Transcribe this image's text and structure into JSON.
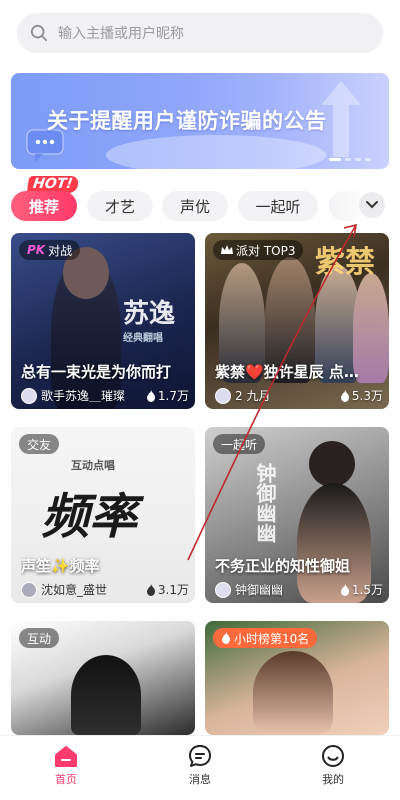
{
  "search": {
    "placeholder": "输入主播或用户昵称"
  },
  "banner": {
    "title": "关于提醒用户谨防诈骗的公告"
  },
  "tabs": {
    "hot_label": "HOT!",
    "items": [
      {
        "label": "推荐",
        "active": true
      },
      {
        "label": "才艺",
        "active": false
      },
      {
        "label": "声优",
        "active": false
      },
      {
        "label": "一起听",
        "active": false
      }
    ]
  },
  "cards": [
    {
      "badge": "对战",
      "badge_prefix": "PK",
      "title": "总有一束光是为你而打",
      "host": "歌手苏逸＿璀璨",
      "heat": "1.7万",
      "art_text": "苏逸",
      "art_sub": "经典翻唱"
    },
    {
      "badge": "派对 TOP3",
      "title": "紫禁❤️独许星辰 点…",
      "host": "2 九月",
      "heat": "5.3万",
      "art_text": "紫禁"
    },
    {
      "badge": "交友",
      "title": "声笙✨频率",
      "host": "沈如意_盛世",
      "heat": "3.1万",
      "art_text": "频率",
      "art_sub": "互动点唱"
    },
    {
      "badge": "一起听",
      "title": "不务正业的知性御姐",
      "host": "钟御幽幽",
      "heat": "1.5万",
      "art_text": "钟御幽幽"
    },
    {
      "badge": "互动"
    },
    {
      "badge": "小时榜第10名"
    }
  ],
  "nav": {
    "items": [
      {
        "label": "首页",
        "active": true
      },
      {
        "label": "消息",
        "active": false
      },
      {
        "label": "我的",
        "active": false
      }
    ]
  },
  "colors": {
    "accent": "#ff3a6c",
    "banner": "#8fa6fb",
    "badge_orange": "#ff6a3d"
  }
}
